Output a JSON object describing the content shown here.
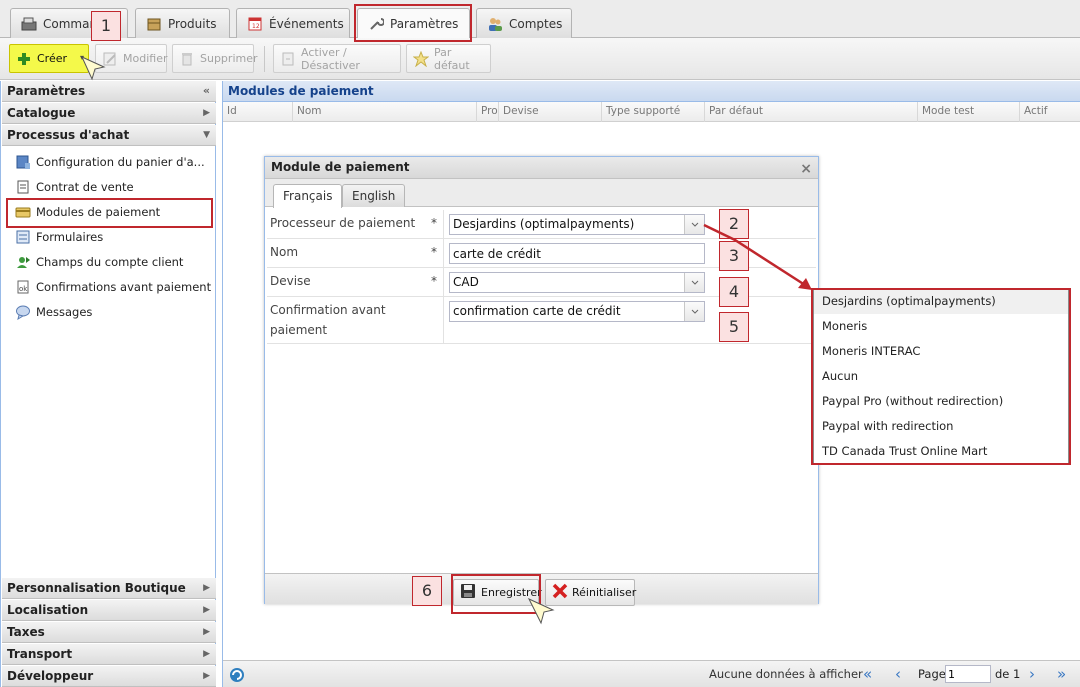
{
  "tabs": [
    {
      "label": "Commandes",
      "icon": "register-icon"
    },
    {
      "label": "Produits",
      "icon": "box-icon"
    },
    {
      "label": "Événements",
      "icon": "calendar-icon"
    },
    {
      "label": "Paramètres",
      "icon": "wrench-icon"
    },
    {
      "label": "Comptes",
      "icon": "users-icon"
    }
  ],
  "toolbar": {
    "create": "Créer",
    "edit": "Modifier",
    "delete": "Supprimer",
    "toggle": "Activer / Désactiver",
    "default": "Par défaut"
  },
  "sidebar": {
    "title": "Paramètres",
    "catalogue": "Catalogue",
    "processus": "Processus d'achat",
    "items": [
      {
        "label": "Configuration du panier d'a...",
        "icon": "cart-config-icon"
      },
      {
        "label": "Contrat de vente",
        "icon": "contract-icon"
      },
      {
        "label": "Modules de paiement",
        "icon": "payment-icon"
      },
      {
        "label": "Formulaires",
        "icon": "form-icon"
      },
      {
        "label": "Champs du compte client",
        "icon": "user-fields-icon"
      },
      {
        "label": "Confirmations avant paiement",
        "icon": "confirm-icon"
      },
      {
        "label": "Messages",
        "icon": "message-icon"
      }
    ],
    "bottom": [
      {
        "label": "Personnalisation Boutique"
      },
      {
        "label": "Localisation"
      },
      {
        "label": "Taxes"
      },
      {
        "label": "Transport"
      },
      {
        "label": "Développeur"
      }
    ]
  },
  "main": {
    "title": "Modules de paiement",
    "columns": [
      "Id",
      "Nom",
      "Pro",
      "Devise",
      "Type supporté",
      "Par défaut",
      "Mode test",
      "Actif"
    ],
    "empty_text": "Aucune données à afficher",
    "page_label": "Page",
    "page_value": "1",
    "page_of": "de 1"
  },
  "dialog": {
    "title": "Module de paiement",
    "tabs": [
      "Français",
      "English"
    ],
    "fields": {
      "processor": {
        "label": "Processeur de paiement",
        "value": "Desjardins (optimalpayments)"
      },
      "name": {
        "label": "Nom",
        "value": "carte de crédit"
      },
      "currency": {
        "label": "Devise",
        "value": "CAD"
      },
      "confirmation": {
        "label_line1": "Confirmation avant",
        "label_line2": "paiement",
        "value": "confirmation carte de crédit"
      }
    },
    "required_mark": "*",
    "save": "Enregistrer",
    "reset": "Réinitialiser"
  },
  "dropdown_options": [
    "Desjardins (optimalpayments)",
    "Moneris",
    "Moneris INTERAC",
    "Aucun",
    "Paypal Pro (without redirection)",
    "Paypal with redirection",
    "TD Canada Trust Online Mart"
  ],
  "annotations": [
    "1",
    "2",
    "3",
    "4",
    "5",
    "6"
  ],
  "colors": {
    "annotation": "#c0272d",
    "create_highlight": "#f4f94a"
  }
}
